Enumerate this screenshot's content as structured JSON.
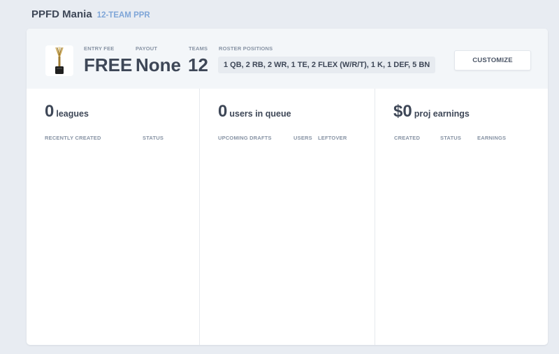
{
  "header": {
    "title": "PPFD Mania",
    "subtitle": "12-TEAM PPR"
  },
  "summary": {
    "trophy_icon": "trophy-icon",
    "entry_fee": {
      "label": "ENTRY FEE",
      "value": "FREE"
    },
    "payout": {
      "label": "PAYOUT",
      "value": "None"
    },
    "teams": {
      "label": "TEAMS",
      "value": "12"
    },
    "roster": {
      "label": "ROSTER POSITIONS",
      "value": "1 QB, 2 RB, 2 WR, 1 TE, 2 FLEX (W/R/T), 1 K, 1 DEF, 5 BN"
    },
    "customize_label": "CUSTOMIZE"
  },
  "columns": {
    "leagues": {
      "count": "0",
      "label": "leagues",
      "headers": [
        "RECENTLY CREATED",
        "STATUS"
      ]
    },
    "queue": {
      "count": "0",
      "label": "users in queue",
      "headers": [
        "UPCOMING DRAFTS",
        "USERS",
        "LEFTOVER"
      ]
    },
    "earnings": {
      "count": "$0",
      "label": "proj earnings",
      "headers": [
        "CREATED",
        "STATUS",
        "EARNINGS"
      ]
    }
  },
  "colors": {
    "background": "#e8ecf2",
    "accent": "#7fa6d8",
    "text_dark": "#3e4757",
    "text_muted": "#8793a4"
  }
}
